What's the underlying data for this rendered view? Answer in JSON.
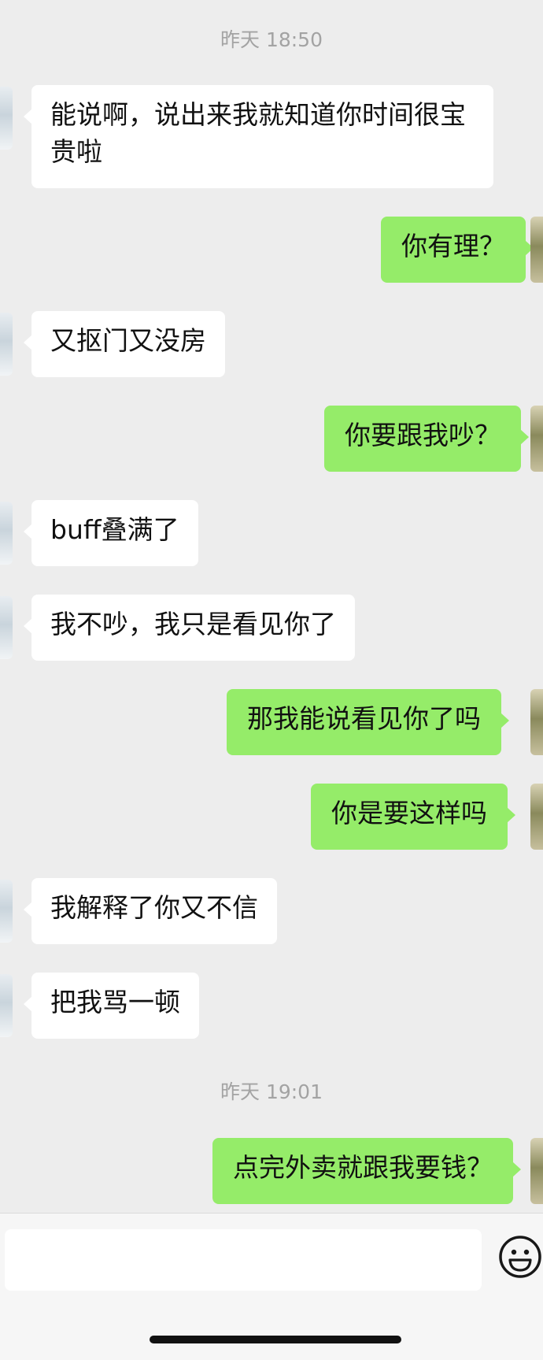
{
  "timestamps": [
    "昨天 18:50",
    "昨天 19:01"
  ],
  "messages": [
    {
      "side": "in",
      "text": "能说啊，说出来我就知道你时间很宝贵啦"
    },
    {
      "side": "out",
      "text": "你有理？"
    },
    {
      "side": "in",
      "text": "又抠门又没房"
    },
    {
      "side": "out",
      "text": "你要跟我吵？"
    },
    {
      "side": "in",
      "text": "buff叠满了"
    },
    {
      "side": "in",
      "text": "我不吵，我只是看见你了"
    },
    {
      "side": "out",
      "text": "那我能说看见你了吗"
    },
    {
      "side": "out",
      "text": "你是要这样吗"
    },
    {
      "side": "in",
      "text": "我解释了你又不信"
    },
    {
      "side": "in",
      "text": "把我骂一顿"
    },
    {
      "side": "out",
      "text": "点完外卖就跟我要钱？"
    }
  ],
  "input": {
    "value": "",
    "placeholder": ""
  },
  "icons": {
    "emoji_button": "smiley-face-icon"
  },
  "colors": {
    "background": "#ededed",
    "incoming_bubble": "#ffffff",
    "outgoing_bubble": "#95ec69"
  }
}
